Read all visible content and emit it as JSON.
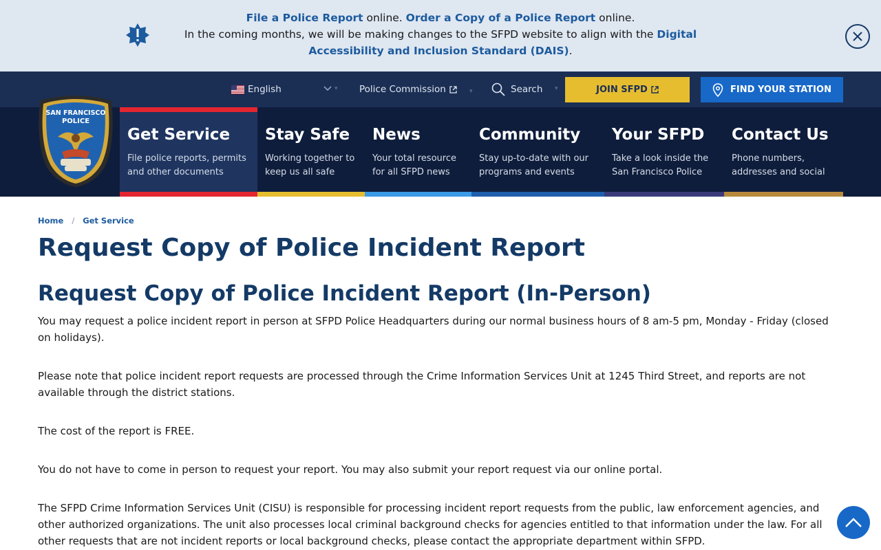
{
  "alert": {
    "link_file": "File a Police Report",
    "text_online_1": " online. ",
    "link_order": "Order a Copy of a Police Report",
    "text_online_2": " online.",
    "line2_prefix": "In the coming months, we will be making changes to the SFPD website to align with the ",
    "link_dais": "Digital Accessibility and Inclusion Standard (DAIS)",
    "line2_suffix": ".",
    "icon": "exclamation-badge-icon"
  },
  "utility": {
    "language": "English",
    "police_commission": "Police Commission",
    "search": "Search",
    "join": "JOIN SFPD",
    "find_station": "FIND YOUR STATION"
  },
  "logo": {
    "top_text": "SAN FRANCISCO",
    "mid_text": "POLICE"
  },
  "nav": [
    {
      "title": "Get Service",
      "desc": "File police reports, permits and other documents",
      "color": "#e3262f"
    },
    {
      "title": "Stay Safe",
      "desc": "Working together to keep us all safe",
      "color": "#e6bd2f"
    },
    {
      "title": "News",
      "desc": "Your total resource for all SFPD news",
      "color": "#3b9be6"
    },
    {
      "title": "Community",
      "desc": "Stay up-to-date with our programs and events",
      "color": "#1f5fae"
    },
    {
      "title": "Your SFPD",
      "desc": "Take a look inside the San Francisco Police",
      "color": "#3b3a7a"
    },
    {
      "title": "Contact Us",
      "desc": "Phone numbers, addresses and social",
      "color": "#b8893c"
    }
  ],
  "breadcrumb": {
    "home": "Home",
    "separator": "/",
    "current": "Get Service"
  },
  "page": {
    "title": "Request Copy of Police Incident Report",
    "section_title": "Request Copy of Police Incident Report (In-Person)",
    "paragraphs": [
      "You may request a police incident report in person at SFPD Police Headquarters during our normal business hours of 8 am-5 pm, Monday - Friday (closed on holidays).",
      "Please note that police incident report requests are processed through the Crime Information Services Unit at 1245 Third Street, and reports are not available through the district stations.",
      "The cost of the report is FREE.",
      "You do not have to come in person to request your report. You may also submit your report request via our online portal.",
      "The SFPD Crime Information Services Unit (CISU) is responsible for processing incident report requests from the public, law enforcement agencies, and other authorized organizations. The unit also processes local criminal background checks for agencies entitled to that information under the law. For all other requests that are not incident reports or local background checks, please contact the appropriate department within SFPD."
    ]
  },
  "colors": {
    "brand_navy": "#0f1d3c",
    "utility_bar": "#1b2f55",
    "link_blue": "#1c5b9e",
    "heading": "#143a66",
    "join_yellow": "#e6bd2f",
    "station_blue": "#1868c8"
  }
}
